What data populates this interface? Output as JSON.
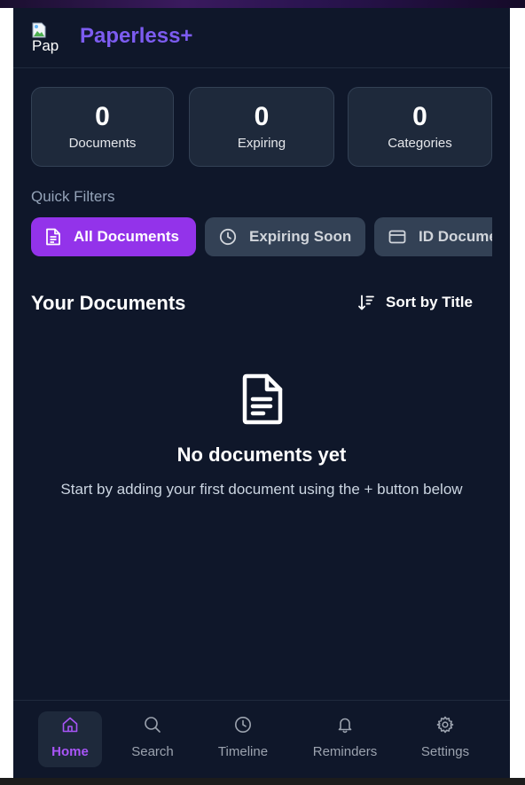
{
  "app": {
    "title": "Paperless+",
    "logo_alt": "Pap"
  },
  "stats": [
    {
      "value": "0",
      "label": "Documents"
    },
    {
      "value": "0",
      "label": "Expiring"
    },
    {
      "value": "0",
      "label": "Categories"
    }
  ],
  "quick_filters": {
    "label": "Quick Filters",
    "chips": [
      {
        "label": "All Documents",
        "icon": "file-text-icon",
        "active": true
      },
      {
        "label": "Expiring Soon",
        "icon": "clock-icon",
        "active": false
      },
      {
        "label": "ID Documents",
        "icon": "id-card-icon",
        "active": false
      }
    ]
  },
  "documents": {
    "title": "Your Documents",
    "sort_label": "Sort by Title",
    "empty_title": "No documents yet",
    "empty_text": "Start by adding your first document using the + button below"
  },
  "nav": [
    {
      "label": "Home",
      "icon": "home-icon",
      "active": true
    },
    {
      "label": "Search",
      "icon": "search-icon",
      "active": false
    },
    {
      "label": "Timeline",
      "icon": "clock-icon",
      "active": false
    },
    {
      "label": "Reminders",
      "icon": "bell-icon",
      "active": false
    },
    {
      "label": "Settings",
      "icon": "gear-icon",
      "active": false
    }
  ],
  "colors": {
    "background": "#0f172a",
    "brand": "#7c5cf0",
    "active_chip": "#9333ea",
    "active_nav_text": "#a855f7"
  }
}
